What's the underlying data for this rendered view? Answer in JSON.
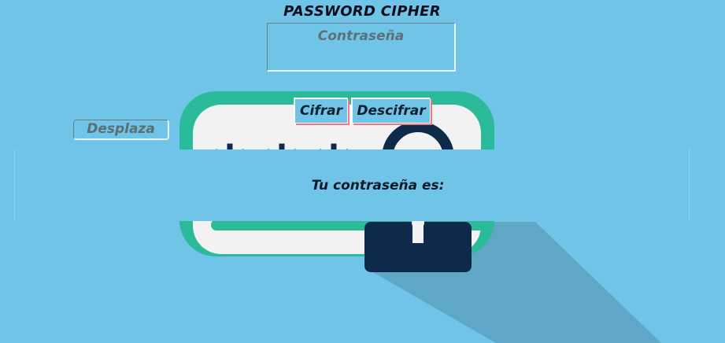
{
  "app": {
    "title": "PASSWORD CIPHER"
  },
  "password": {
    "placeholder": "Contraseña",
    "value": ""
  },
  "slider": {
    "label": "Desplaza"
  },
  "actions": {
    "encrypt_label": "Cifrar",
    "decrypt_label": "Descifrar"
  },
  "result": {
    "label": "Tu contraseña es:",
    "value": ""
  },
  "illustration": {
    "masked_text": "***",
    "icons": [
      "padlock-icon",
      "keyhole-icon"
    ]
  },
  "colors": {
    "background": "#70c4e8",
    "card_border": "#2bbb9a",
    "card_fill": "#f2f2f2",
    "lock_body": "#0e2a4a",
    "shadow": "#5ea7c6",
    "button_shadow": "#ef7a86"
  }
}
